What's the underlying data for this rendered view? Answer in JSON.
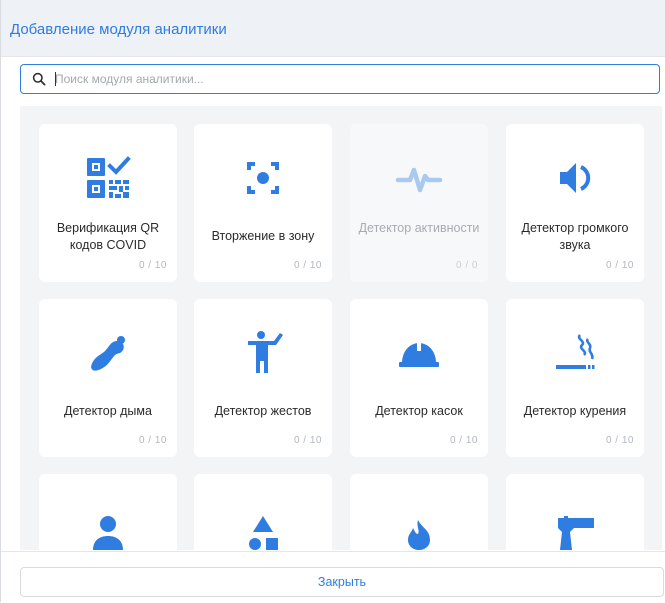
{
  "dialog": {
    "title": "Добавление модуля аналитики",
    "search_placeholder": "Поиск модуля аналитики...",
    "close_label": "Закрыть",
    "accent_color": "#2f7de1"
  },
  "modules": [
    {
      "label": "Верификация QR кодов COVID",
      "count": "0 / 10",
      "icon": "qr-check-icon",
      "enabled": true
    },
    {
      "label": "Вторжение в зону",
      "count": "0 / 10",
      "icon": "zone-focus-icon",
      "enabled": true
    },
    {
      "label": "Детектор активности",
      "count": "0 / 0",
      "icon": "activity-pulse-icon",
      "enabled": false
    },
    {
      "label": "Детектор громкого звука",
      "count": "0 / 10",
      "icon": "loud-sound-icon",
      "enabled": true
    },
    {
      "label": "Детектор дыма",
      "count": "0 / 10",
      "icon": "smoke-icon",
      "enabled": true
    },
    {
      "label": "Детектор жестов",
      "count": "0 / 10",
      "icon": "gesture-person-icon",
      "enabled": true
    },
    {
      "label": "Детектор касок",
      "count": "0 / 10",
      "icon": "hard-hat-icon",
      "enabled": true
    },
    {
      "label": "Детектор курения",
      "count": "0 / 10",
      "icon": "smoking-icon",
      "enabled": true
    },
    {
      "label": "",
      "count": "",
      "icon": "person-icon",
      "enabled": true
    },
    {
      "label": "",
      "count": "",
      "icon": "shapes-icon",
      "enabled": true
    },
    {
      "label": "",
      "count": "",
      "icon": "fire-icon",
      "enabled": true
    },
    {
      "label": "",
      "count": "",
      "icon": "pistol-icon",
      "enabled": true
    }
  ]
}
